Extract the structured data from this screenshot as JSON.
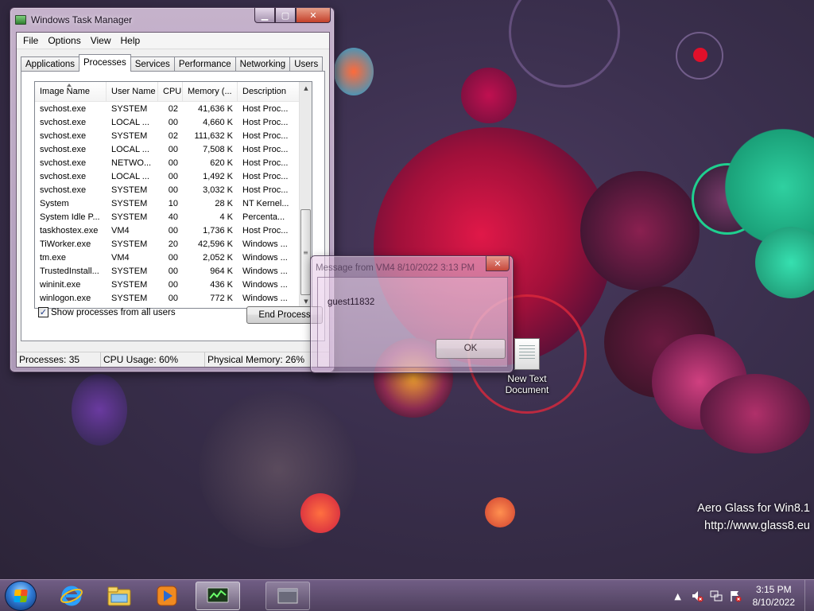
{
  "colors": {
    "accent_magenta": "#d4145a",
    "wallpaper_base": "#3a2f4d",
    "close_red": "#c4402a"
  },
  "taskmgr": {
    "title": "Windows Task Manager",
    "menu": [
      "File",
      "Options",
      "View",
      "Help"
    ],
    "tabs": [
      {
        "label": "Applications",
        "active": false
      },
      {
        "label": "Processes",
        "active": true
      },
      {
        "label": "Services",
        "active": false
      },
      {
        "label": "Performance",
        "active": false
      },
      {
        "label": "Networking",
        "active": false
      },
      {
        "label": "Users",
        "active": false
      }
    ],
    "columns": [
      "Image Name",
      "User Name",
      "CPU",
      "Memory (...",
      "Description"
    ],
    "rows": [
      [
        "svchost.exe",
        "SYSTEM",
        "02",
        "41,636 K",
        "Host Proc..."
      ],
      [
        "svchost.exe",
        "LOCAL ...",
        "00",
        "4,660 K",
        "Host Proc..."
      ],
      [
        "svchost.exe",
        "SYSTEM",
        "02",
        "111,632 K",
        "Host Proc..."
      ],
      [
        "svchost.exe",
        "LOCAL ...",
        "00",
        "7,508 K",
        "Host Proc..."
      ],
      [
        "svchost.exe",
        "NETWO...",
        "00",
        "620 K",
        "Host Proc..."
      ],
      [
        "svchost.exe",
        "LOCAL ...",
        "00",
        "1,492 K",
        "Host Proc..."
      ],
      [
        "svchost.exe",
        "SYSTEM",
        "00",
        "3,032 K",
        "Host Proc..."
      ],
      [
        "System",
        "SYSTEM",
        "10",
        "28 K",
        "NT Kernel..."
      ],
      [
        "System Idle P...",
        "SYSTEM",
        "40",
        "4 K",
        "Percenta..."
      ],
      [
        "taskhostex.exe",
        "VM4",
        "00",
        "1,736 K",
        "Host Proc..."
      ],
      [
        "TiWorker.exe",
        "SYSTEM",
        "20",
        "42,596 K",
        "Windows ..."
      ],
      [
        "tm.exe",
        "VM4",
        "00",
        "2,052 K",
        "Windows ..."
      ],
      [
        "TrustedInstall...",
        "SYSTEM",
        "00",
        "964 K",
        "Windows ..."
      ],
      [
        "wininit.exe",
        "SYSTEM",
        "00",
        "436 K",
        "Windows ..."
      ],
      [
        "winlogon.exe",
        "SYSTEM",
        "00",
        "772 K",
        "Windows ..."
      ]
    ],
    "show_all_label": "Show processes from all users",
    "show_all_checked": "✓",
    "end_process_label": "End Process",
    "status": {
      "processes": "Processes: 35",
      "cpu": "CPU Usage: 60%",
      "memory": "Physical Memory: 26%"
    },
    "caption": {
      "min": "▁",
      "max": "▢",
      "close": "✕"
    }
  },
  "message": {
    "title": "Message from VM4 8/10/2022 3:13 PM",
    "body": "guest11832",
    "ok_label": "OK",
    "close": "✕"
  },
  "desktop_icon": {
    "label_line1": "New Text",
    "label_line2": "Document",
    "icon": "text-document-icon"
  },
  "watermark": {
    "line1": "Aero Glass for Win8.1",
    "line2": "http://www.glass8.eu"
  },
  "taskbar": {
    "pinned": [
      "internet-explorer-icon",
      "file-explorer-icon",
      "media-player-icon",
      "task-manager-icon",
      "window-icon"
    ],
    "tray": {
      "chevron": "▲",
      "clock_time": "3:15 PM",
      "clock_date": "8/10/2022"
    }
  }
}
